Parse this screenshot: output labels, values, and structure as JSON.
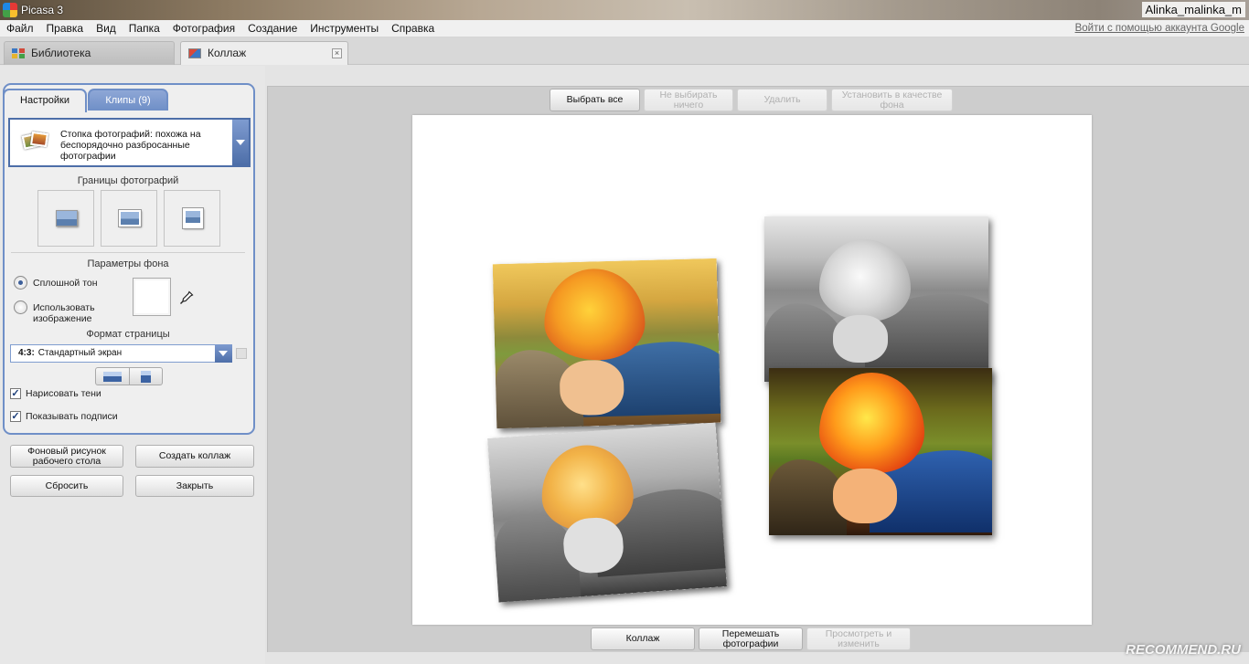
{
  "window": {
    "title": "Picasa 3",
    "user": "Alinka_malinka_m"
  },
  "menu": {
    "items": [
      "Файл",
      "Правка",
      "Вид",
      "Папка",
      "Фотография",
      "Создание",
      "Инструменты",
      "Справка"
    ],
    "signin": "Войти с помощью аккаунта Google"
  },
  "tabs": {
    "library": "Библиотека",
    "collage": "Коллаж",
    "close": "×"
  },
  "panel": {
    "tab_settings": "Настройки",
    "tab_clips": "Клипы (9)",
    "style": "Стопка фотографий: похожа на беспорядочно разбросанные фотографии",
    "borders_label": "Границы фотографий",
    "background_label": "Параметры фона",
    "solid_color": "Сплошной тон",
    "use_image": "Использовать изображение",
    "page_format_label": "Формат страницы",
    "page_format_ratio": "4:3:",
    "page_format_name": "Стандартный экран",
    "draw_shadows": "Нарисовать тени",
    "show_captions": "Показывать подписи",
    "shadows_checked": true,
    "captions_checked": true,
    "background_color": "#ffffff"
  },
  "actions": {
    "desktop_bg": "Фоновый рисунок рабочего стола",
    "create_collage": "Создать коллаж",
    "reset": "Сбросить",
    "close": "Закрыть"
  },
  "toolbar": {
    "select_all": "Выбрать все",
    "select_none": "Не выбирать ничего",
    "delete": "Удалить",
    "set_background": "Установить в качестве фона"
  },
  "bottom": {
    "collage": "Коллаж",
    "shuffle": "Перемешать фотографии",
    "view_edit": "Просмотреть и изменить"
  },
  "watermark": "RECOMMEND.RU"
}
